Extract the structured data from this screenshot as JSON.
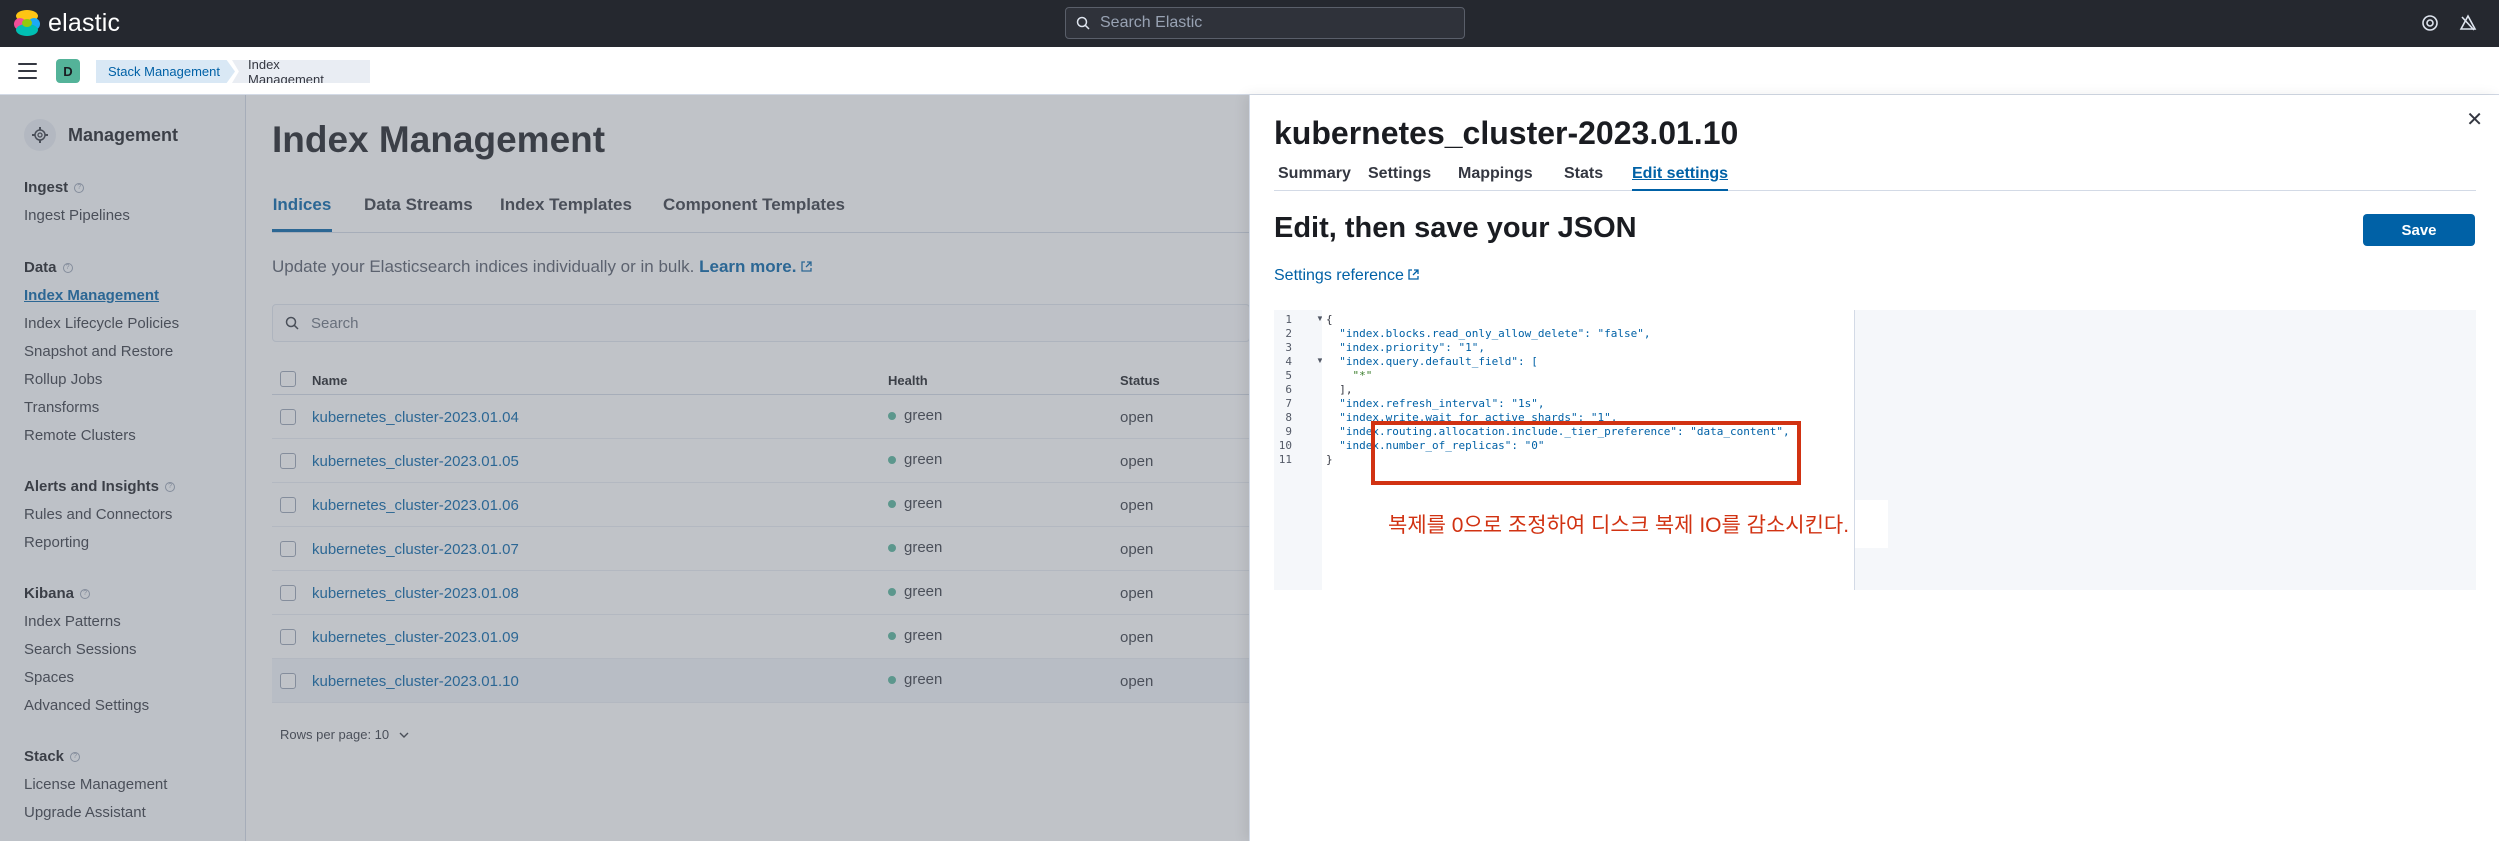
{
  "app": {
    "logo_text": "elastic",
    "search_placeholder": "Search Elastic",
    "space_initial": "D"
  },
  "breadcrumbs": [
    "Stack Management",
    "Index Management"
  ],
  "sidebar": {
    "title": "Management",
    "sections": [
      {
        "title": "Ingest",
        "items": [
          "Ingest Pipelines"
        ]
      },
      {
        "title": "Data",
        "items": [
          "Index Management",
          "Index Lifecycle Policies",
          "Snapshot and Restore",
          "Rollup Jobs",
          "Transforms",
          "Remote Clusters"
        ]
      },
      {
        "title": "Alerts and Insights",
        "items": [
          "Rules and Connectors",
          "Reporting"
        ]
      },
      {
        "title": "Kibana",
        "items": [
          "Index Patterns",
          "Search Sessions",
          "Spaces",
          "Advanced Settings"
        ]
      },
      {
        "title": "Stack",
        "items": [
          "License Management",
          "Upgrade Assistant"
        ]
      }
    ],
    "active_item": "Index Management"
  },
  "main": {
    "title": "Index Management",
    "tabs": [
      "Indices",
      "Data Streams",
      "Index Templates",
      "Component Templates"
    ],
    "active_tab": "Indices",
    "description": "Update your Elasticsearch indices individually or in bulk.",
    "learn_more": "Learn more.",
    "search_placeholder": "Search",
    "columns": [
      "Name",
      "Health",
      "Status"
    ],
    "rows": [
      {
        "name": "kubernetes_cluster-2023.01.04",
        "health": "green",
        "status": "open"
      },
      {
        "name": "kubernetes_cluster-2023.01.05",
        "health": "green",
        "status": "open"
      },
      {
        "name": "kubernetes_cluster-2023.01.06",
        "health": "green",
        "status": "open"
      },
      {
        "name": "kubernetes_cluster-2023.01.07",
        "health": "green",
        "status": "open"
      },
      {
        "name": "kubernetes_cluster-2023.01.08",
        "health": "green",
        "status": "open"
      },
      {
        "name": "kubernetes_cluster-2023.01.09",
        "health": "green",
        "status": "open"
      },
      {
        "name": "kubernetes_cluster-2023.01.10",
        "health": "green",
        "status": "open"
      }
    ],
    "rows_per_page": "Rows per page: 10"
  },
  "flyout": {
    "title": "kubernetes_cluster-2023.01.10",
    "tabs": [
      "Summary",
      "Settings",
      "Mappings",
      "Stats",
      "Edit settings"
    ],
    "active_tab": "Edit settings",
    "heading": "Edit, then save your JSON",
    "save_label": "Save",
    "settings_reference": "Settings reference",
    "code_lines": [
      "{",
      "  \"index.blocks.read_only_allow_delete\": \"false\",",
      "  \"index.priority\": \"1\",",
      "  \"index.query.default_field\": [",
      "    \"*\"",
      "  ],",
      "  \"index.refresh_interval\": \"1s\",",
      "  \"index.write.wait_for_active_shards\": \"1\",",
      "  \"index.routing.allocation.include._tier_preference\": \"data_content\",",
      "  \"index.number_of_replicas\": \"0\"",
      "}"
    ],
    "annotation": "복제를 0으로 조정하여 디스크 복제 IO를 감소시킨다."
  }
}
